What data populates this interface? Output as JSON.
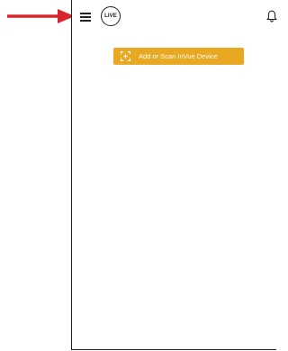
{
  "app": {
    "logo_text": "LIVE"
  },
  "header": {
    "menu_icon": "hamburger-menu-icon",
    "notification_icon": "bell-icon"
  },
  "main": {
    "add_button_label": "Add or Scan InVue Device",
    "add_button_icon": "scan-frame-icon"
  },
  "colors": {
    "accent": "#e8a821",
    "annotation_arrow": "#d8252b",
    "border": "#1f1f1f"
  }
}
